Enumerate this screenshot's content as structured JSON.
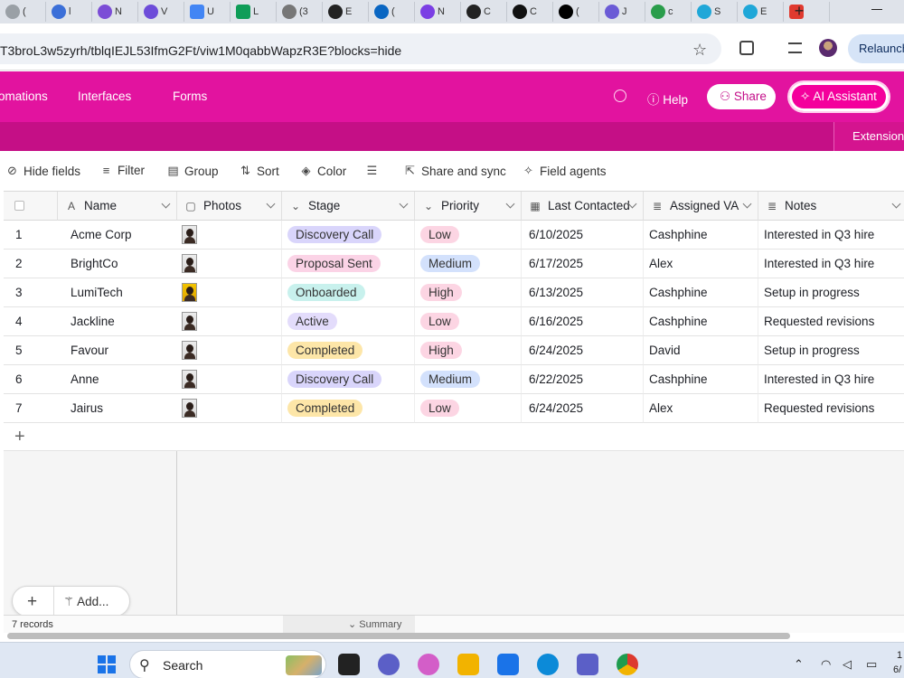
{
  "browser": {
    "tabs": [
      {
        "icon": "generic-page-icon",
        "title": "(",
        "color": "#9aa0a6"
      },
      {
        "icon": "wordpress-icon",
        "title": "l",
        "color": "#3b6fd8"
      },
      {
        "icon": "copilot-icon",
        "title": "N",
        "color": "#7b4dd6"
      },
      {
        "icon": "gear-icon",
        "title": "V",
        "color": "#6d4cd9"
      },
      {
        "icon": "docs-icon",
        "title": "U",
        "color": "#4285f4"
      },
      {
        "icon": "sheets-icon",
        "title": "L",
        "color": "#0f9d58"
      },
      {
        "icon": "speaker-icon",
        "title": "(3",
        "color": "#777777"
      },
      {
        "icon": "chatgpt-icon",
        "title": "E",
        "color": "#222222"
      },
      {
        "icon": "linkedin-icon",
        "title": "(",
        "color": "#0a66c2"
      },
      {
        "icon": "meet-icon",
        "title": "N",
        "color": "#7b3fe4"
      },
      {
        "icon": "chatgpt-icon",
        "title": "C",
        "color": "#222222"
      },
      {
        "icon": "upwork-icon",
        "title": "C",
        "color": "#111111"
      },
      {
        "icon": "x-icon",
        "title": "(",
        "color": "#000000"
      },
      {
        "icon": "wordpress-icon",
        "title": "J",
        "color": "#6b5bd6"
      },
      {
        "icon": "grammar-icon",
        "title": "c",
        "color": "#2a9d4b"
      },
      {
        "icon": "canva-icon",
        "title": "S",
        "color": "#1fa7d8"
      },
      {
        "icon": "canva-icon",
        "title": "E",
        "color": "#1fa7d8"
      },
      {
        "icon": "red-square-icon",
        "title": "",
        "color": "#e03a2f"
      }
    ],
    "url": "T3broL3w5zyrh/tblqIEJL53IfmG2Ft/viw1M0qabbWapzR3E?blocks=hide",
    "relaunch_label": "Relaunch"
  },
  "app": {
    "nav": [
      "omations",
      "Interfaces",
      "Forms"
    ],
    "help_label": "Help",
    "share_label": "Share",
    "ai_label": "AI Assistant",
    "extensions_label": "Extensions",
    "brand_color": "#e2139f"
  },
  "toolbar": [
    {
      "icon": "eye-off-icon",
      "label": "Hide fields"
    },
    {
      "icon": "filter-icon",
      "label": "Filter"
    },
    {
      "icon": "group-icon",
      "label": "Group"
    },
    {
      "icon": "sort-icon",
      "label": "Sort"
    },
    {
      "icon": "paint-bucket-icon",
      "label": "Color"
    },
    {
      "icon": "row-height-icon",
      "label": ""
    },
    {
      "icon": "share-sync-icon",
      "label": "Share and sync"
    },
    {
      "icon": "sparkle-icon",
      "label": "Field agents"
    }
  ],
  "table": {
    "columns": [
      {
        "key": "name",
        "label": "Name",
        "icon": "text-field-icon"
      },
      {
        "key": "photos",
        "label": "Photos",
        "icon": "attachment-icon"
      },
      {
        "key": "stage",
        "label": "Stage",
        "icon": "select-icon"
      },
      {
        "key": "priority",
        "label": "Priority",
        "icon": "select-icon"
      },
      {
        "key": "last_contacted",
        "label": "Last Contacted",
        "icon": "calendar-icon"
      },
      {
        "key": "assigned_va",
        "label": "Assigned VA",
        "icon": "long-text-icon"
      },
      {
        "key": "notes",
        "label": "Notes",
        "icon": "long-text-icon"
      }
    ],
    "rows": [
      {
        "n": "1",
        "name": "Acme Corp",
        "photo": "portrait",
        "stage": "Discovery Call",
        "priority": "Low",
        "last_contacted": "6/10/2025",
        "assigned_va": "Cashphine",
        "notes": "Interested in Q3 hire"
      },
      {
        "n": "2",
        "name": "BrightCo",
        "photo": "portrait",
        "stage": "Proposal Sent",
        "priority": "Medium",
        "last_contacted": "6/17/2025",
        "assigned_va": "Alex",
        "notes": "Interested in Q3 hire"
      },
      {
        "n": "3",
        "name": "LumiTech",
        "photo": "portrait-yellow",
        "stage": "Onboarded",
        "priority": "High",
        "last_contacted": "6/13/2025",
        "assigned_va": "Cashphine",
        "notes": "Setup in progress"
      },
      {
        "n": "4",
        "name": "Jackline",
        "photo": "portrait",
        "stage": "Active",
        "priority": "Low",
        "last_contacted": "6/16/2025",
        "assigned_va": "Cashphine",
        "notes": "Requested revisions"
      },
      {
        "n": "5",
        "name": "Favour",
        "photo": "portrait",
        "stage": "Completed",
        "priority": "High",
        "last_contacted": "6/24/2025",
        "assigned_va": "David",
        "notes": "Setup in progress"
      },
      {
        "n": "6",
        "name": "Anne",
        "photo": "portrait",
        "stage": "Discovery Call",
        "priority": "Medium",
        "last_contacted": "6/22/2025",
        "assigned_va": "Cashphine",
        "notes": "Interested in Q3 hire"
      },
      {
        "n": "7",
        "name": "Jairus",
        "photo": "portrait",
        "stage": "Completed",
        "priority": "Low",
        "last_contacted": "6/24/2025",
        "assigned_va": "Alex",
        "notes": "Requested revisions"
      }
    ],
    "stage_colors": {
      "Discovery Call": "#d9d5fb",
      "Proposal Sent": "#fbd3e6",
      "Onboarded": "#c8f1ed",
      "Active": "#e3dcfb",
      "Completed": "#fde6a8"
    },
    "priority_colors": {
      "Low": "#fcd5e3",
      "Medium": "#d3e1fc",
      "High": "#fcd5e3"
    },
    "add_label": "Add...",
    "records_label": "7 records",
    "summary_label": "Summary"
  },
  "taskbar": {
    "search_label": "Search",
    "apps": [
      {
        "icon": "task-view-icon",
        "color": "#222222"
      },
      {
        "icon": "chat-icon",
        "color": "#5b5fc7"
      },
      {
        "icon": "copilot-icon",
        "color": "#d35ec8"
      },
      {
        "icon": "folder-icon",
        "color": "#f2b300"
      },
      {
        "icon": "store-icon",
        "color": "#1a73e8"
      },
      {
        "icon": "edge-icon",
        "color": "#0c8ad8"
      },
      {
        "icon": "teams-icon",
        "color": "#5b5fc7"
      },
      {
        "icon": "chrome-icon",
        "color": "#dd3a2e"
      }
    ],
    "clock_fragments": [
      "1",
      "6/"
    ]
  }
}
